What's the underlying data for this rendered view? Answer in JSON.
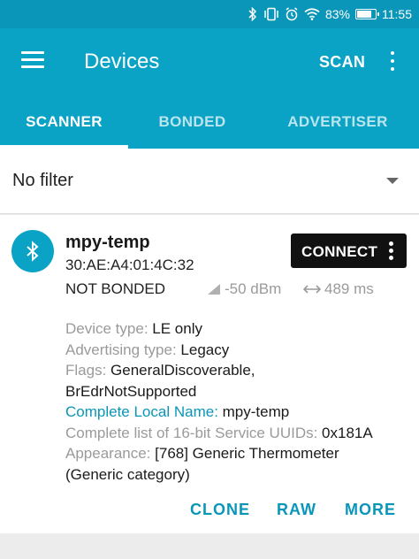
{
  "status_bar": {
    "battery_text": "83%",
    "battery_level": 0.83,
    "time": "11:55",
    "icons": [
      "bluetooth-icon",
      "vibrate-icon",
      "alarm-icon",
      "wifi-icon",
      "battery-icon"
    ]
  },
  "app_bar": {
    "title": "Devices",
    "scan_label": "SCAN",
    "menu_icon": "hamburger-menu-icon",
    "overflow_icon": "more-vert-icon"
  },
  "tabs": [
    {
      "label": "SCANNER",
      "active": true
    },
    {
      "label": "BONDED",
      "active": false
    },
    {
      "label": "ADVERTISER",
      "active": false
    }
  ],
  "filter": {
    "value": "No filter",
    "icon": "dropdown-arrow-icon"
  },
  "device": {
    "name": "mpy-temp",
    "address": "30:AE:A4:01:4C:32",
    "bond_state": "NOT BONDED",
    "rssi": "-50 dBm",
    "interval": "489 ms",
    "connect_label": "CONNECT",
    "details": {
      "device_type_label": "Device type: ",
      "device_type_value": "LE only",
      "adv_type_label": "Advertising type: ",
      "adv_type_value": "Legacy",
      "flags_label": "Flags: ",
      "flags_value_1": "GeneralDiscoverable,",
      "flags_value_2": "BrEdrNotSupported",
      "local_name_label": "Complete Local Name: ",
      "local_name_value": "mpy-temp",
      "uuids_label": "Complete list of 16-bit Service UUIDs: ",
      "uuids_value": "0x181A",
      "appearance_label": "Appearance: ",
      "appearance_value_1": "[768] Generic Thermometer",
      "appearance_value_2": "(Generic category)"
    },
    "actions": {
      "clone": "CLONE",
      "raw": "RAW",
      "more": "MORE"
    }
  },
  "colors": {
    "status_bar": "#0a96b8",
    "primary": "#0aa3c6",
    "accent_text": "#0a96b8",
    "connect_button": "#111111"
  }
}
